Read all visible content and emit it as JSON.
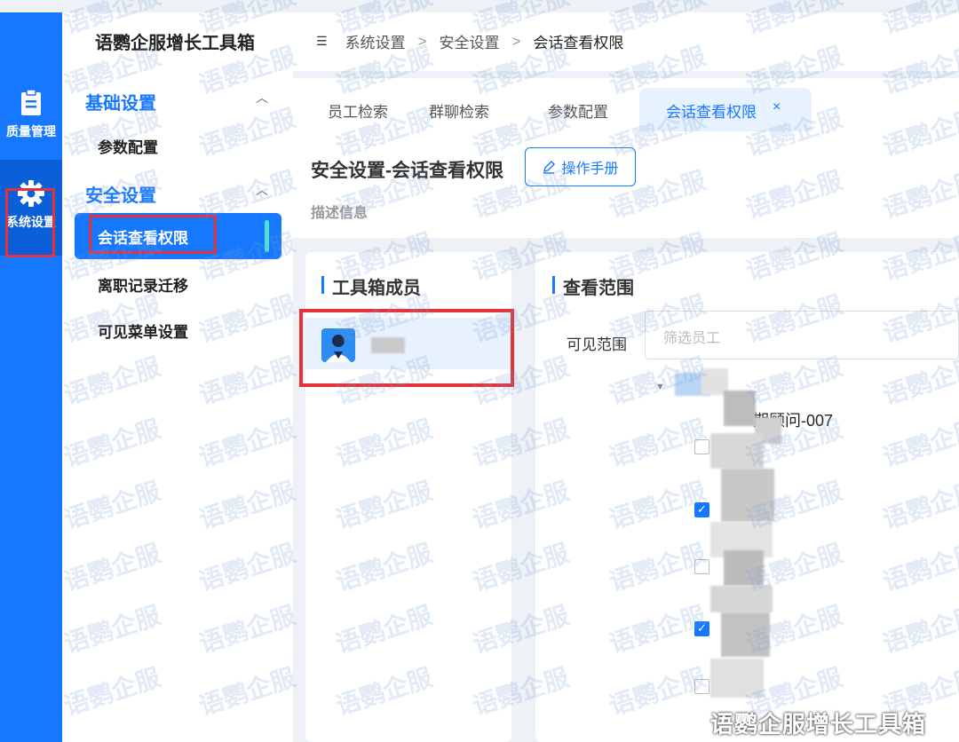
{
  "rail": {
    "items": [
      {
        "label": "质量管理",
        "icon": "clipboard-icon"
      },
      {
        "label": "系统设置",
        "icon": "gear-icon"
      }
    ]
  },
  "brand": "语鹦企服增长工具箱",
  "menu": {
    "groups": [
      {
        "label": "基础设置",
        "items": [
          "参数配置"
        ]
      },
      {
        "label": "安全设置",
        "items": [
          "会话查看权限",
          "离职记录迁移",
          "可见菜单设置"
        ]
      }
    ]
  },
  "breadcrumb": {
    "items": [
      "系统设置",
      "安全设置",
      "会话查看权限"
    ],
    "separator": ">",
    "menu_icon": "☰"
  },
  "tabs": {
    "items": [
      "员工检索",
      "群聊检索",
      "参数配置",
      "会话查看权限"
    ],
    "close": "×"
  },
  "page": {
    "title": "安全设置-会话查看权限",
    "manual_button": "操作手册",
    "description": "描述信息"
  },
  "members_panel": {
    "title": "工具箱成员"
  },
  "scope_panel": {
    "title": "查看范围",
    "visible_label": "可见范围",
    "filter_placeholder": "筛选员工",
    "tree": [
      {
        "text": "期顾问-007",
        "checked": false
      },
      {
        "text": "",
        "checked": false
      },
      {
        "text": "",
        "checked": true
      },
      {
        "text": "",
        "checked": false
      },
      {
        "text": "",
        "checked": true
      },
      {
        "text": "",
        "checked": false
      }
    ]
  },
  "watermark": "语鹦企服",
  "footer_watermark": "语鹦企服增长工具箱",
  "colors": {
    "primary": "#1677ff",
    "highlight": "#e5313a"
  }
}
